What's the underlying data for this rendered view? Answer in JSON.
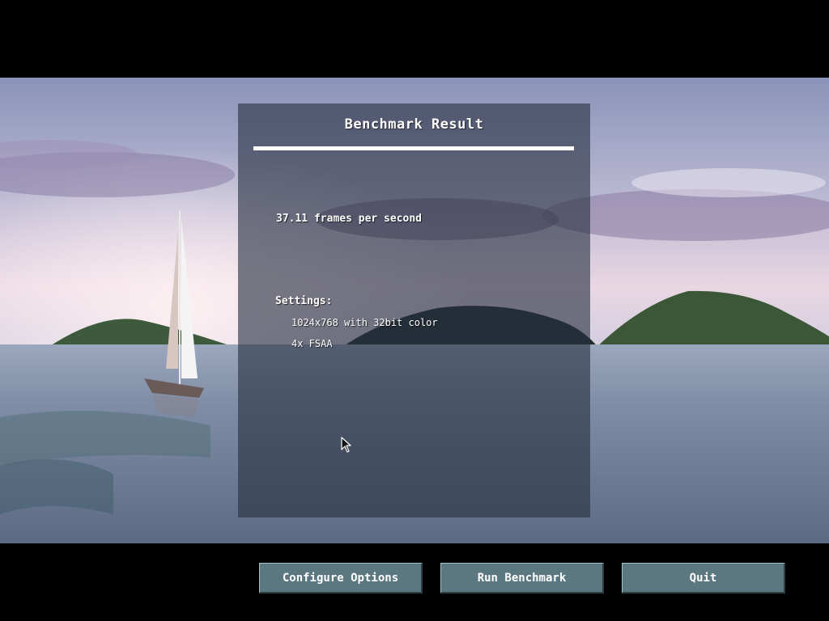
{
  "panel": {
    "title": "Benchmark Result",
    "fps_text": "37.11 frames per second",
    "settings_heading": "Settings:",
    "settings_items": [
      "1024x768 with 32bit color",
      "4x FSAA"
    ]
  },
  "buttons": {
    "configure_label": "Configure Options",
    "run_label": "Run Benchmark",
    "quit_label": "Quit"
  },
  "colors": {
    "button_fill": "#5b7780",
    "panel_overlay": "#28304299",
    "text": "#ffffff"
  },
  "icons": {
    "cursor": "mouse-pointer-icon"
  }
}
